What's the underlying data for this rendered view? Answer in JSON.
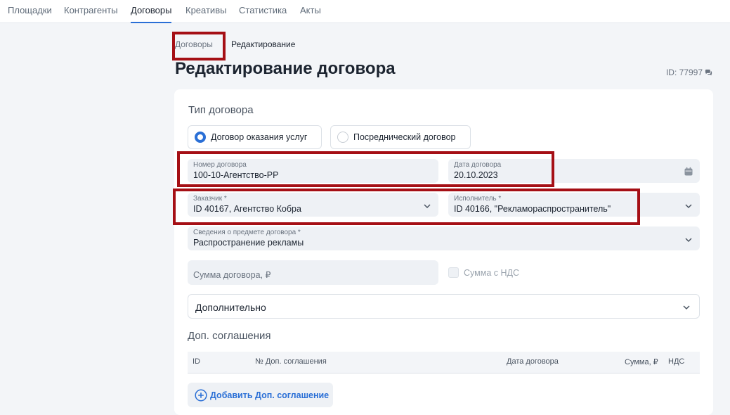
{
  "nav": {
    "items": [
      "Площадки",
      "Контрагенты",
      "Договоры",
      "Креативы",
      "Статистика",
      "Акты"
    ],
    "active_index": 2
  },
  "breadcrumb": {
    "parent": "Договоры",
    "current": "Редактирование"
  },
  "page": {
    "title": "Редактирование договора",
    "id_label": "ID: 77997"
  },
  "contract_type": {
    "title": "Тип договора",
    "options": [
      "Договор оказания услуг",
      "Посреднический договор"
    ],
    "selected_index": 0
  },
  "fields": {
    "number": {
      "label": "Номер договора",
      "value": "100-10-Агентство-РР"
    },
    "date": {
      "label": "Дата договора",
      "value": "20.10.2023"
    },
    "customer": {
      "label": "Заказчик *",
      "value": "ID 40167, Агентство Кобра"
    },
    "executor": {
      "label": "Исполнитель *",
      "value": "ID 40166, \"Рекламораспространитель\""
    },
    "subject": {
      "label": "Сведения о предмете договора *",
      "value": "Распространение рекламы"
    },
    "amount": {
      "placeholder": "Сумма договора, ₽"
    },
    "vat_checkbox": {
      "label": "Сумма с НДС",
      "checked": false
    }
  },
  "extra": {
    "label": "Дополнительно"
  },
  "supplements": {
    "title": "Доп. соглашения",
    "columns": [
      "ID",
      "№ Доп. соглашения",
      "Дата договора",
      "Сумма, ₽",
      "НДС"
    ],
    "rows": [],
    "add_button": "Добавить Доп. соглашение"
  },
  "colors": {
    "accent": "#2a6fd6",
    "highlight": "#a50f15",
    "field_bg": "#eef1f5",
    "page_bg": "#f3f5f8"
  },
  "icons": [
    "calendar-icon",
    "chevron-down-icon",
    "plus-circle-icon",
    "comments-icon"
  ]
}
